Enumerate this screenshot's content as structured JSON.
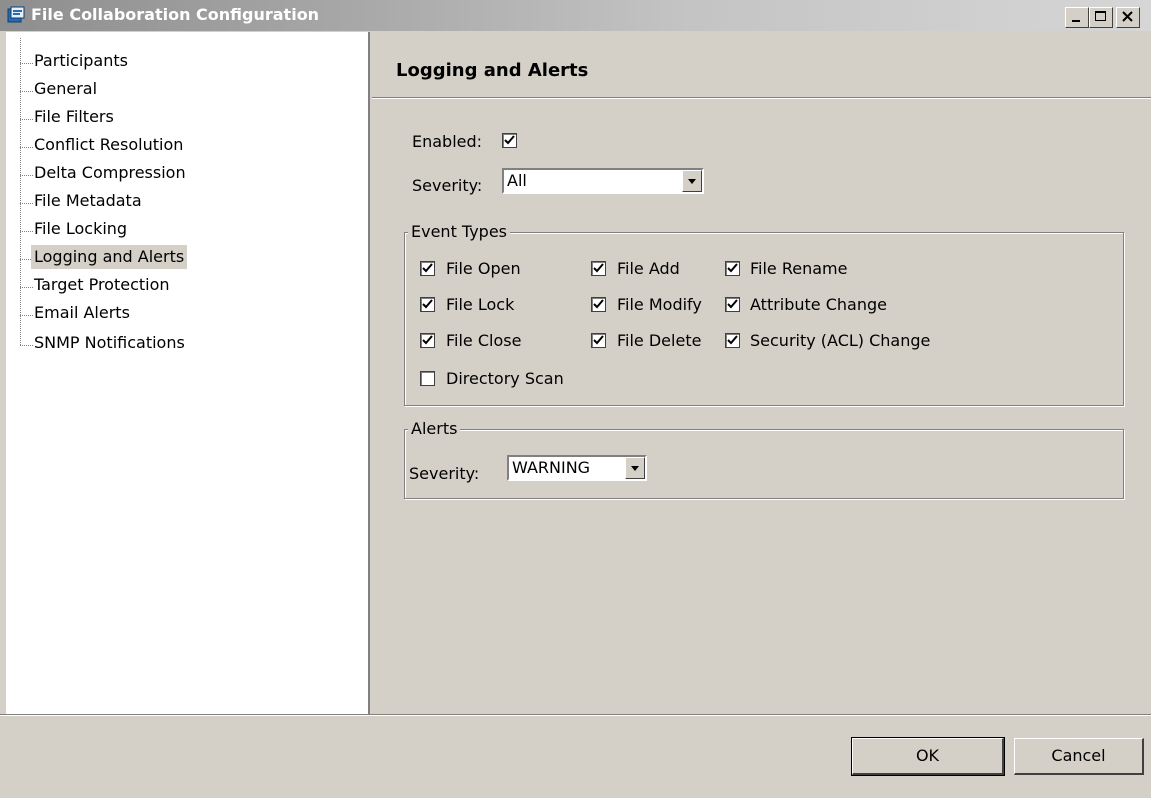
{
  "window": {
    "title": "File Collaboration Configuration"
  },
  "tree": {
    "items": [
      {
        "label": "Participants"
      },
      {
        "label": "General"
      },
      {
        "label": "File Filters"
      },
      {
        "label": "Conflict Resolution"
      },
      {
        "label": "Delta Compression"
      },
      {
        "label": "File Metadata"
      },
      {
        "label": "File Locking"
      },
      {
        "label": "Logging and Alerts",
        "selected": true
      },
      {
        "label": "Target Protection"
      },
      {
        "label": "Email Alerts"
      },
      {
        "label": "SNMP Notifications"
      }
    ]
  },
  "panel": {
    "title": "Logging and Alerts",
    "enabled_label": "Enabled:",
    "enabled_checked": true,
    "severity_label": "Severity:",
    "severity_value": "All"
  },
  "event_types": {
    "title": "Event Types",
    "items": [
      {
        "label": "File Open",
        "checked": true
      },
      {
        "label": "File Add",
        "checked": true
      },
      {
        "label": "File Rename",
        "checked": true
      },
      {
        "label": "File Lock",
        "checked": true
      },
      {
        "label": "File Modify",
        "checked": true
      },
      {
        "label": "Attribute Change",
        "checked": true
      },
      {
        "label": "File Close",
        "checked": true
      },
      {
        "label": "File Delete",
        "checked": true
      },
      {
        "label": "Security (ACL) Change",
        "checked": true
      },
      {
        "label": "Directory Scan",
        "checked": false
      }
    ]
  },
  "alerts": {
    "title": "Alerts",
    "severity_label": "Severity:",
    "severity_value": "WARNING"
  },
  "buttons": {
    "ok": "OK",
    "cancel": "Cancel"
  },
  "icons": {
    "app": "app-config-icon",
    "minimize": "minimize-icon",
    "maximize": "maximize-icon",
    "close": "close-icon",
    "dropdown": "chevron-down-icon",
    "check": "check-icon"
  }
}
